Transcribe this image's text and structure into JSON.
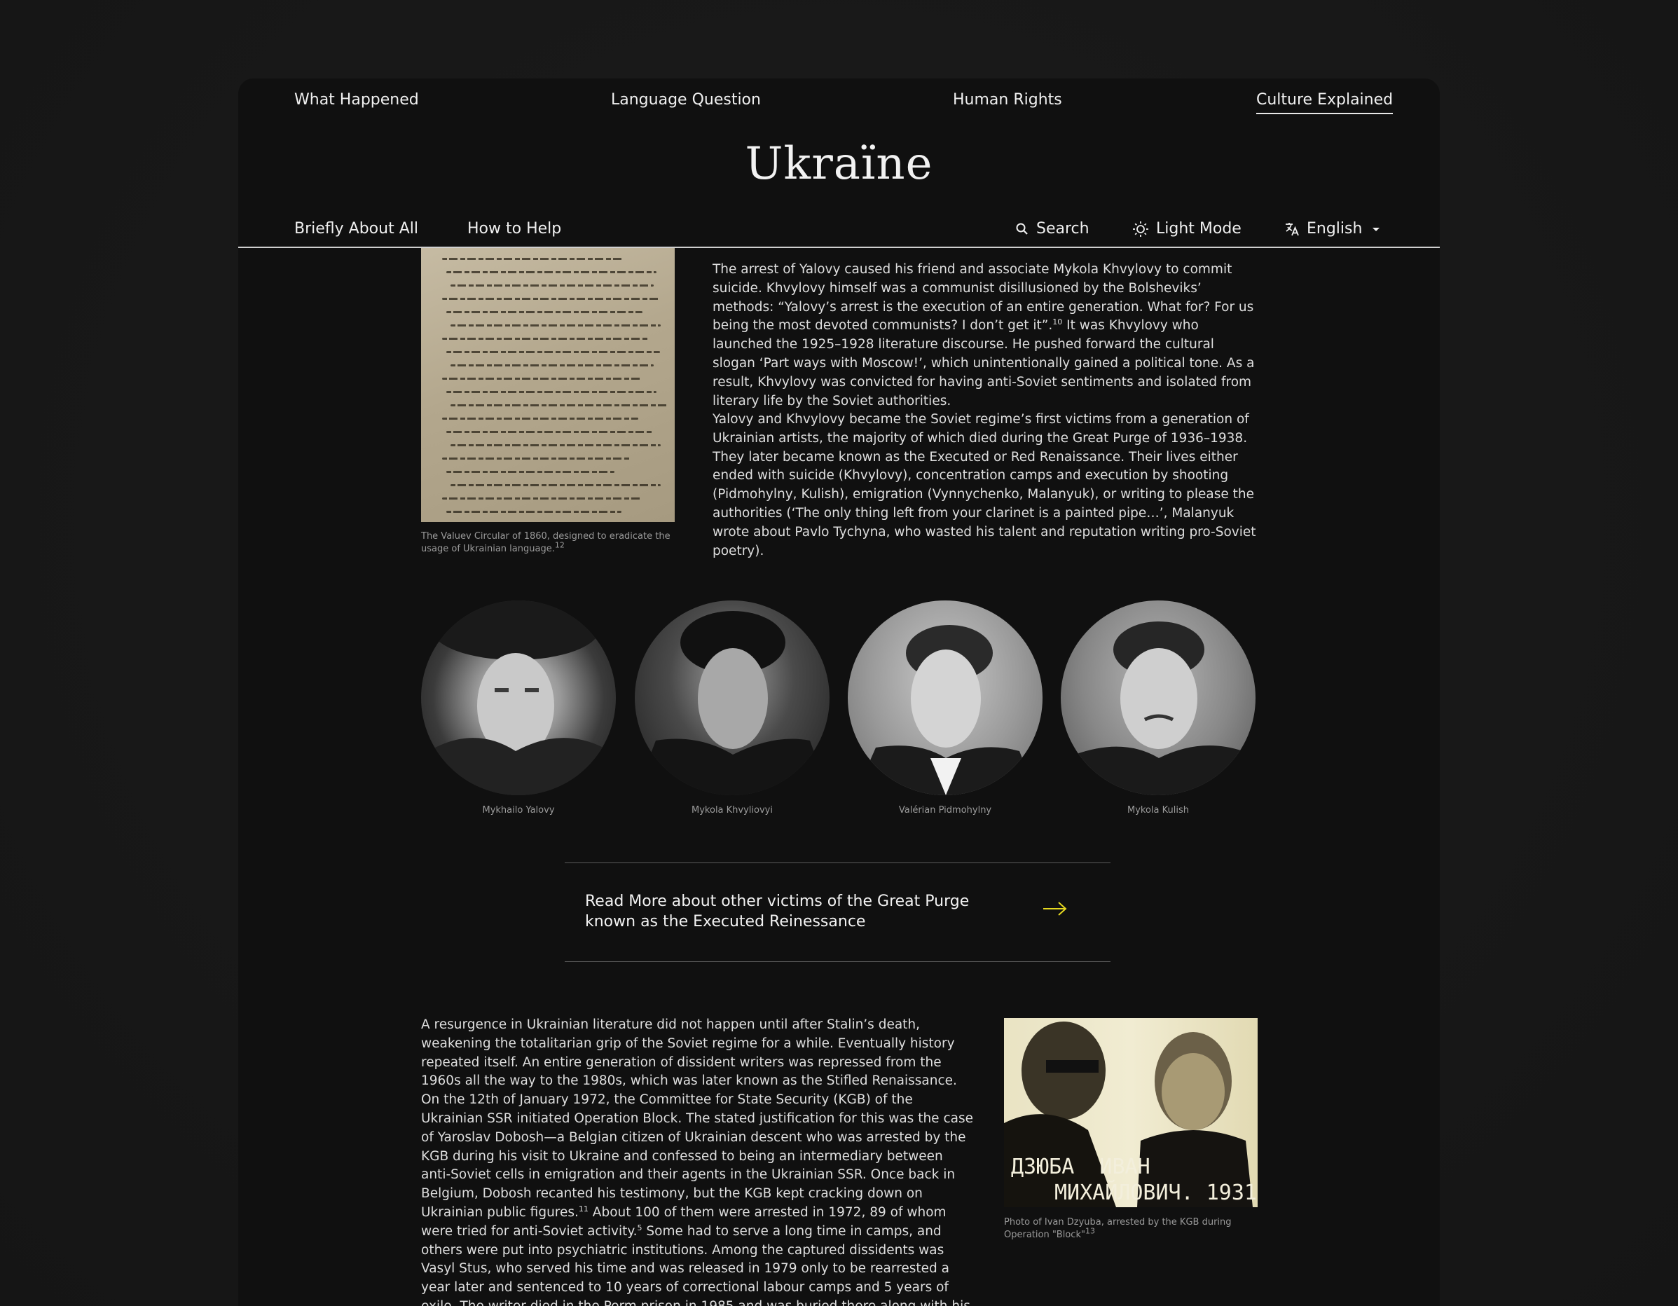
{
  "header": {
    "top_links": [
      "What Happened",
      "Language Question",
      "Human Rights",
      "Culture Explained"
    ],
    "active_link": "Culture Explained",
    "logo": "Ukraїne",
    "sub_left": [
      "Briefly About All",
      "How to Help"
    ],
    "search_label": "Search",
    "mode_label": "Light Mode",
    "language_label": "English",
    "icons": [
      "search-icon",
      "sun-icon",
      "translate-icon",
      "caret-down-icon"
    ]
  },
  "section1": {
    "figure_caption": "The Valuev Circular of 1860, designed to eradicate the usage of Ukrainian language.",
    "figure_caption_ref": "12",
    "para1_a": "The arrest of Yalovy caused his friend and associate Mykola Khvylovy to commit suicide. Khvylovy himself was a communist disillusioned by the Bolsheviks’ methods: “Yalovy’s arrest is the execution of an entire generation. What for? For us being the most devoted communists? I don’t get it”.",
    "para1_ref": "10",
    "para1_b": " It was Khvylovy who launched the 1925–1928 literature discourse. He pushed forward the cultural slogan ‘Part ways with Moscow!’, which unintentionally gained a political tone. As a result, Khvylovy was convicted for having anti-Soviet sentiments and isolated from literary life by the Soviet authorities.",
    "para2": "Yalovy and Khvylovy became the Soviet regime’s first victims from a generation of Ukrainian artists, the majority of which died during the Great Purge of 1936–1938. They later became known as the Executed or Red Renaissance. Their lives either ended with suicide (Khvylovy), concentration camps and execution by shooting (Pidmohylny, Kulish), emigration (Vynnychenko, Malanyuk), or writing to please the authorities (‘The only thing left from your clarinet is a painted pipe…’, Malanyuk wrote about Pavlo Tychyna, who wasted his talent and reputation writing pro-Soviet poetry)."
  },
  "portraits": [
    {
      "name": "Mykhailo Yalovy"
    },
    {
      "name": "Mykola Khvyliovyi"
    },
    {
      "name": "Valérian Pidmohylny"
    },
    {
      "name": "Mykola Kulish"
    }
  ],
  "cta": {
    "text": "Read More about other victims of the Great Purge known as the Executed Reinessance",
    "arrow_color": "#e5d820"
  },
  "section2": {
    "para_a": "A resurgence in Ukrainian literature did not happen until after Stalin’s death, weakening the totalitarian grip of the Soviet regime for a while. Eventually history repeated itself. An entire generation of dissident writers was repressed from the 1960s all the way to the 1980s, which was later known as the Stifled Renaissance. On the 12th of January 1972, the Committee for State Security (KGB) of the Ukrainian SSR initiated Operation Block. The stated justification for this was the case of Yaroslav Dobosh—a Belgian citizen of Ukrainian descent who was arrested by the KGB during his visit to Ukraine and confessed to being an intermediary between anti-Soviet cells in emigration and their agents in the Ukrainian SSR. Once back in Belgium, Dobosh recanted his testimony, but the KGB kept cracking down on Ukrainian public figures.",
    "ref_a": "11",
    "para_b": "  About 100 of them were arrested in 1972, 89 of whom were tried for anti-Soviet activity.",
    "ref_b": "5",
    "para_c": " Some had to serve a long time in camps, and others were put into psychiatric institutions. Among the captured dissidents was Vasyl Stus, who served his time and was released in 1979 only to be rearrested a year later and sentenced to 10 years of correctional labour camps and 5 years of exile. The writer died in the Perm prison in 1985 and was buried there along with his family, protesting the decision. He remained a big name after his death and his",
    "photo_text_1": "ДЗЮБА  ИВАН",
    "photo_text_2": "МИХАЙЛОВИЧ. 1931",
    "photo_caption": "Photo of Ivan Dzyuba, arrested by the KGB during Operation \"Block\"",
    "photo_caption_ref": "13"
  }
}
